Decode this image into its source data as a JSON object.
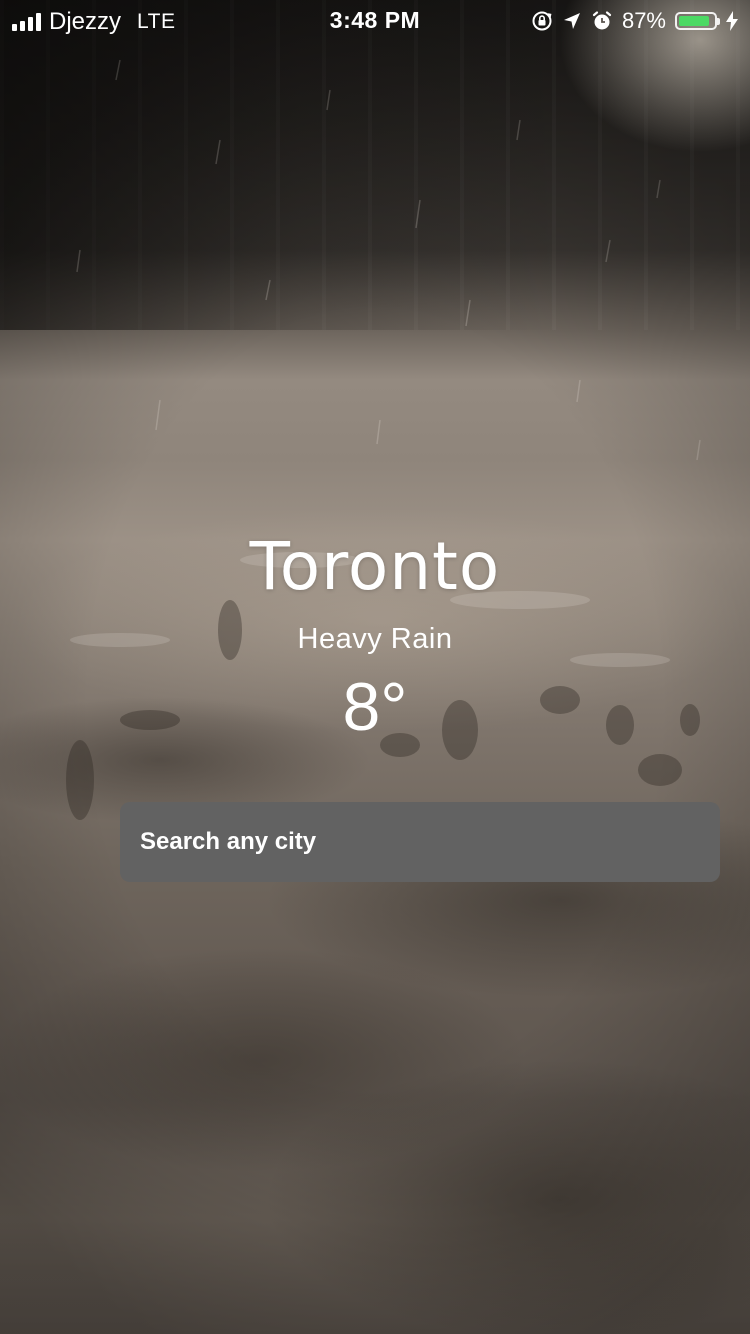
{
  "status_bar": {
    "carrier": "Djezzy",
    "network": "LTE",
    "time": "3:48 PM",
    "battery_percent_text": "87%",
    "battery_level": 0.87,
    "battery_color": "#4cd964",
    "signal_bars": 4,
    "icons": [
      "orientation-lock-icon",
      "location-arrow-icon",
      "alarm-icon",
      "charging-bolt-icon"
    ]
  },
  "weather": {
    "city": "Toronto",
    "condition": "Heavy Rain",
    "temperature": "8°"
  },
  "search": {
    "placeholder": "Search any city",
    "value": ""
  }
}
